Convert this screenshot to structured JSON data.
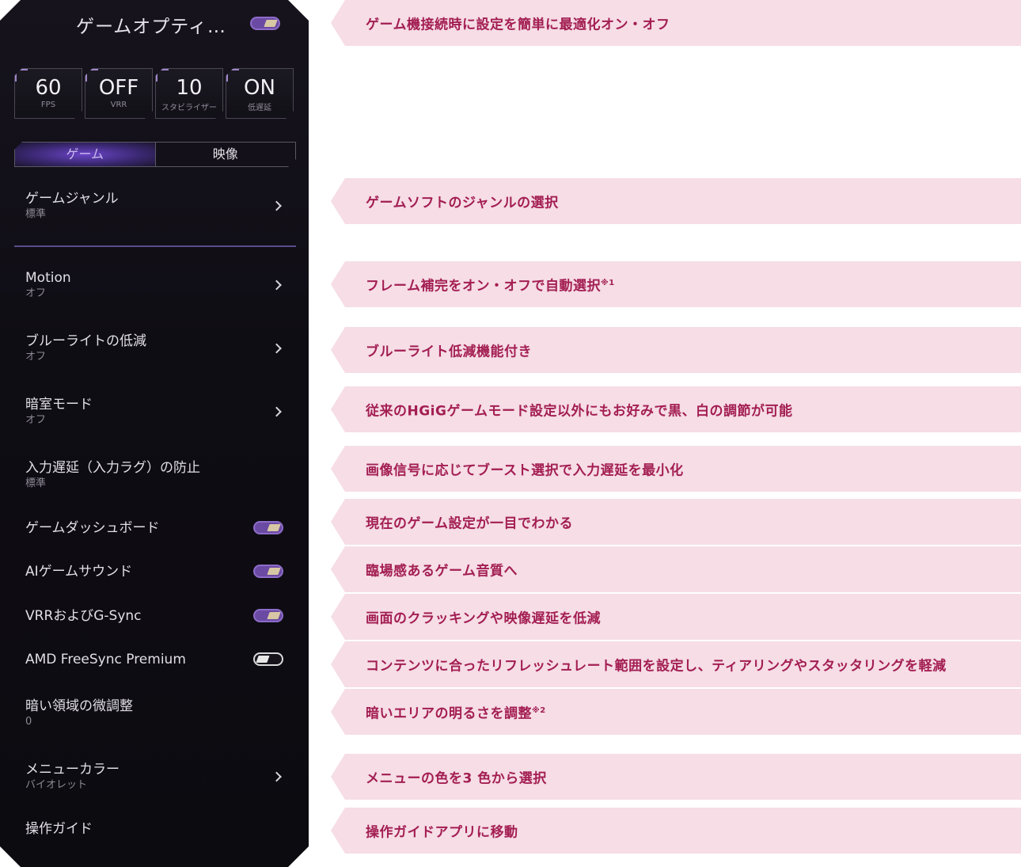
{
  "panel": {
    "title": "ゲームオプティ…",
    "stats": [
      {
        "value": "60",
        "label": "FPS"
      },
      {
        "value": "OFF",
        "label": "VRR"
      },
      {
        "value": "10",
        "label": "スタビライザー"
      },
      {
        "value": "ON",
        "label": "低遅延"
      }
    ],
    "tabs": [
      "ゲーム",
      "映像"
    ],
    "menu": [
      {
        "label": "ゲームジャンル",
        "sub": "標準"
      },
      {
        "label": "Motion",
        "sub": "オフ"
      },
      {
        "label": "ブルーライトの低減",
        "sub": "オフ"
      },
      {
        "label": "暗室モード",
        "sub": "オフ"
      },
      {
        "label": "入力遅延（入力ラグ）の防止",
        "sub": "標準"
      },
      {
        "label": "ゲームダッシュボード",
        "toggle": "on"
      },
      {
        "label": "AIゲームサウンド",
        "toggle": "on"
      },
      {
        "label": "VRRおよびG-Sync",
        "toggle": "on"
      },
      {
        "label": "AMD FreeSync Premium",
        "toggle": "off"
      },
      {
        "label": "暗い領域の微調整",
        "sub": "0"
      },
      {
        "label": "メニューカラー",
        "sub": "バイオレット"
      },
      {
        "label": "操作ガイド"
      }
    ]
  },
  "callouts": [
    {
      "text": "ゲーム機接続時に設定を簡単に最適化オン・オフ"
    },
    {
      "text": "ゲームソフトのジャンルの選択"
    },
    {
      "text": "フレーム補完をオン・オフで自動選択",
      "note": "※1"
    },
    {
      "text": "ブルーライト低減機能付き"
    },
    {
      "text": "従来のHGiGゲームモード設定以外にもお好みで黒、白の調節が可能"
    },
    {
      "text": "画像信号に応じてブースト選択で入力遅延を最小化"
    },
    {
      "text": "現在のゲーム設定が一目でわかる"
    },
    {
      "text": "臨場感あるゲーム音質へ"
    },
    {
      "text": "画面のクラッキングや映像遅延を低減"
    },
    {
      "text": "コンテンツに合ったリフレッシュレート範囲を設定し、ティアリングやスタッタリングを軽減"
    },
    {
      "text": "暗いエリアの明るさを調整",
      "note": "※2"
    },
    {
      "text": "メニューの色を3 色から選択"
    },
    {
      "text": "操作ガイドアプリに移動"
    }
  ],
  "colors": {
    "accent": "#6a4aa3",
    "callout_bg": "#f6dde6",
    "callout_text": "#a31e52"
  }
}
